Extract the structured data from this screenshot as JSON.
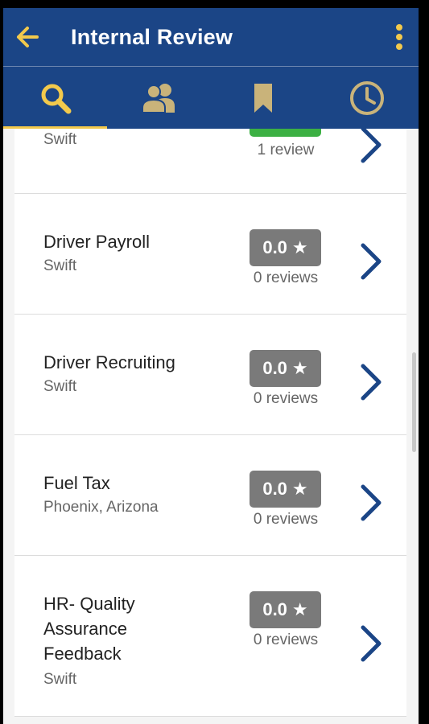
{
  "header": {
    "title": "Internal Review",
    "back_icon": "arrow-left-icon",
    "menu_icon": "more-vertical-icon"
  },
  "tabs": [
    {
      "name": "search",
      "icon": "search-icon",
      "active": true
    },
    {
      "name": "people",
      "icon": "people-icon",
      "active": false
    },
    {
      "name": "bookmark",
      "icon": "bookmark-icon",
      "active": false
    },
    {
      "name": "history",
      "icon": "clock-icon",
      "active": false
    }
  ],
  "colors": {
    "primary": "#1b4586",
    "accent": "#f2c94c",
    "rating_badge": "#7a7a7a",
    "rated_badge": "#3cb043"
  },
  "items": [
    {
      "name": "",
      "org": "Swift",
      "rating": "",
      "reviews": "1 review"
    },
    {
      "name": "Driver Payroll",
      "org": "Swift",
      "rating": "0.0",
      "reviews": "0 reviews"
    },
    {
      "name": "Driver Recruiting",
      "org": "Swift",
      "rating": "0.0",
      "reviews": "0 reviews"
    },
    {
      "name": "Fuel Tax",
      "org": "Phoenix, Arizona",
      "rating": "0.0",
      "reviews": "0 reviews"
    },
    {
      "name": "HR- Quality Assurance Feedback",
      "name_lines": [
        "HR- Quality",
        "Assurance",
        "Feedback"
      ],
      "org": "Swift",
      "rating": "0.0",
      "reviews": "0 reviews"
    }
  ],
  "star_glyph": "★"
}
